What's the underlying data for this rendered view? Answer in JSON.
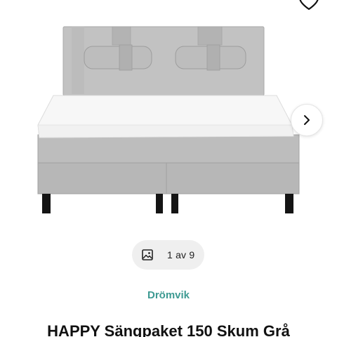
{
  "gallery": {
    "image_alt": "HAPPY Sängpaket 150 Skum Grå",
    "counter_text": "1 av 9",
    "icons": {
      "favorite": "heart-outline-icon",
      "next": "chevron-right-icon",
      "gallery": "image-icon"
    }
  },
  "product": {
    "brand": "Drömvik",
    "title": "HAPPY Sängpaket 150 Skum Grå"
  },
  "colors": {
    "brand_accent": "#3d9a92",
    "pill_background": "#efefef",
    "bed_fabric": "#b9b9b9"
  }
}
